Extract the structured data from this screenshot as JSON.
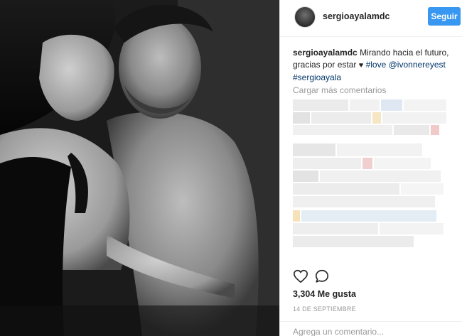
{
  "post": {
    "username": "sergioayalamdc",
    "follow_label": "Seguir",
    "caption": {
      "user": "sergioayalamdc",
      "text_line1": "Mirando hacia el futuro,",
      "text_line2": "gracias por estar",
      "heart": "♥",
      "tag1": "#love",
      "mention": "@ivonnereyest",
      "tag2": "#sergioayala"
    },
    "load_more_label": "Cargar más comentarios",
    "likes_label": "3,304 Me gusta",
    "date_label": "14 DE SEPTIEMBRE",
    "add_comment_placeholder": "Agrega un comentario..."
  },
  "icons": {
    "like": "heart-outline-icon",
    "comment": "speech-bubble-icon"
  },
  "colors": {
    "follow_button": "#3897f0",
    "link": "#003569",
    "muted": "#999999"
  }
}
